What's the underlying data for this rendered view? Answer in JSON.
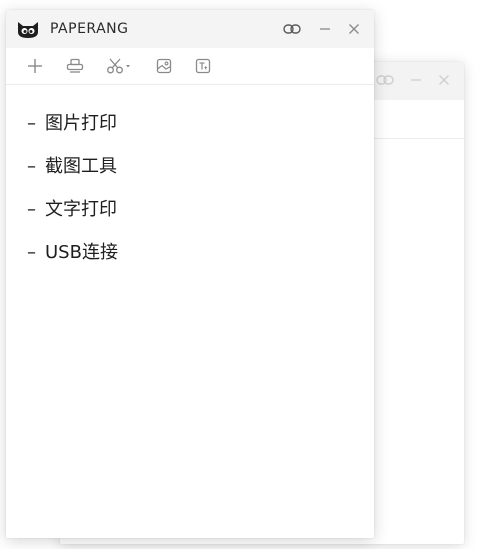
{
  "window": {
    "title": "PAPERANG"
  },
  "toolbar": {
    "tools": [
      {
        "icon": "plus-icon"
      },
      {
        "icon": "printer-icon"
      },
      {
        "icon": "scissors-dropdown-icon"
      },
      {
        "icon": "image-icon"
      },
      {
        "icon": "text-icon"
      }
    ]
  },
  "content": {
    "dash": "–",
    "items": [
      "图片打印",
      "截图工具",
      "文字打印",
      "USB连接"
    ]
  },
  "colors": {
    "titlebar_bg": "#f4f4f4",
    "icon_gray": "#8a8a8a",
    "text": "#1e1e1e"
  }
}
